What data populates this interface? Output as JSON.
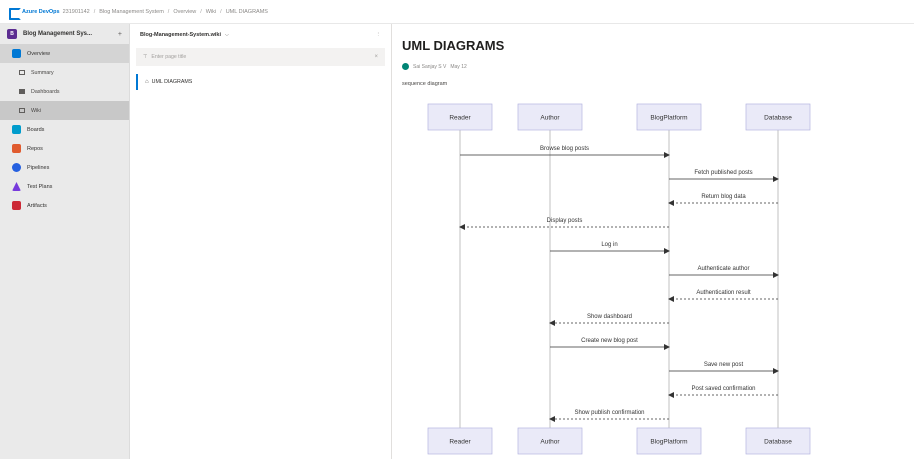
{
  "topbar": {
    "brand": "Azure DevOps",
    "org": "231901142",
    "crumbs": [
      "Blog Management System",
      "Overview",
      "Wiki",
      "UML DIAGRAMS"
    ],
    "separator": "/"
  },
  "sidebar": {
    "project": {
      "initial": "B",
      "name": "Blog Management Sys...",
      "add": "+"
    },
    "items": [
      {
        "label": "Overview",
        "color": "#0078d4",
        "active": true
      },
      {
        "label": "Summary",
        "sub": true
      },
      {
        "label": "Dashboards",
        "sub": true
      },
      {
        "label": "Wiki",
        "sub": true,
        "selected": true
      },
      {
        "label": "Boards",
        "color": "#009ccc"
      },
      {
        "label": "Repos",
        "color": "#e05b2f"
      },
      {
        "label": "Pipelines",
        "color": "#2560e0"
      },
      {
        "label": "Test Plans",
        "color": "#773adc"
      },
      {
        "label": "Artifacts",
        "color": "#cc2936"
      }
    ]
  },
  "wiki": {
    "name": "Blog-Management-System.wiki",
    "chevron": "⌵",
    "more": "⋮",
    "filter_placeholder": "Enter page title",
    "filter_icon": "⊤",
    "filter_clear": "×",
    "pages": [
      {
        "label": "UML DIAGRAMS",
        "icon": "⌂"
      }
    ]
  },
  "page": {
    "title": "UML DIAGRAMS",
    "author": "Sai Sanjay S V",
    "date": "May 12",
    "description": "sequence diagram"
  },
  "diagram": {
    "type": "sequence",
    "participants": [
      "Reader",
      "Author",
      "BlogPlatform",
      "Database"
    ],
    "messages": [
      {
        "from": "Reader",
        "to": "BlogPlatform",
        "label": "Browse blog posts",
        "style": "solid"
      },
      {
        "from": "BlogPlatform",
        "to": "Database",
        "label": "Fetch published posts",
        "style": "solid"
      },
      {
        "from": "Database",
        "to": "BlogPlatform",
        "label": "Return blog data",
        "style": "dashed"
      },
      {
        "from": "BlogPlatform",
        "to": "Reader",
        "label": "Display posts",
        "style": "dashed"
      },
      {
        "from": "Author",
        "to": "BlogPlatform",
        "label": "Log in",
        "style": "solid"
      },
      {
        "from": "BlogPlatform",
        "to": "Database",
        "label": "Authenticate author",
        "style": "solid"
      },
      {
        "from": "Database",
        "to": "BlogPlatform",
        "label": "Authentication result",
        "style": "dashed"
      },
      {
        "from": "BlogPlatform",
        "to": "Author",
        "label": "Show dashboard",
        "style": "dashed"
      },
      {
        "from": "Author",
        "to": "BlogPlatform",
        "label": "Create new blog post",
        "style": "solid"
      },
      {
        "from": "BlogPlatform",
        "to": "Database",
        "label": "Save new post",
        "style": "solid"
      },
      {
        "from": "Database",
        "to": "BlogPlatform",
        "label": "Post saved confirmation",
        "style": "dashed"
      },
      {
        "from": "BlogPlatform",
        "to": "Author",
        "label": "Show publish confirmation",
        "style": "dashed"
      }
    ],
    "colors": {
      "box_fill": "#eaeaf8",
      "box_stroke": "#b5b5e0",
      "line": "#333333",
      "text": "#333333"
    }
  }
}
